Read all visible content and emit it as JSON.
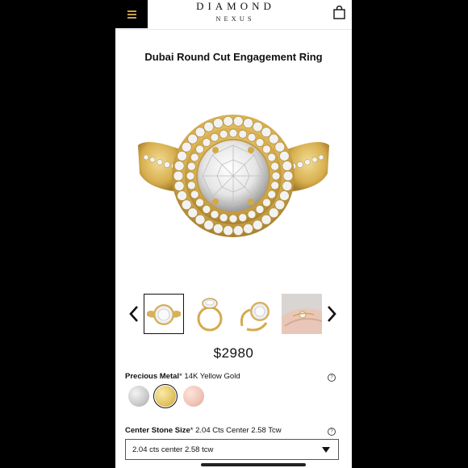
{
  "header": {
    "brand_line1": "DIAMOND",
    "brand_line2": "NEXUS",
    "menu_icon": "hamburger-icon",
    "cart_icon": "shopping-bag-icon"
  },
  "product": {
    "title": "Dubai Round Cut Engagement Ring",
    "price": "$2980"
  },
  "gallery": {
    "prev_icon": "chevron-left-icon",
    "next_icon": "chevron-right-icon",
    "thumbnails": [
      "ring-top-view",
      "ring-side-view",
      "ring-angled-view",
      "ring-on-hand"
    ],
    "selected_index": 0
  },
  "metal": {
    "label": "Precious Metal",
    "required_mark": "*",
    "value": "14K Yellow Gold",
    "swatches": [
      {
        "name": "white-gold",
        "color": "#c9c9c9"
      },
      {
        "name": "yellow-gold",
        "color": "#e2c462"
      },
      {
        "name": "rose-gold",
        "color": "#efc3b5"
      }
    ],
    "selected_index": 1,
    "help": "?"
  },
  "center_stone": {
    "label": "Center Stone Size",
    "required_mark": "*",
    "value": "2.04 Cts Center 2.58 Tcw",
    "help": "?",
    "select_value": "2.04 cts center 2.58 tcw"
  },
  "colors": {
    "accent_gold": "#c9a14a",
    "text": "#111111"
  }
}
